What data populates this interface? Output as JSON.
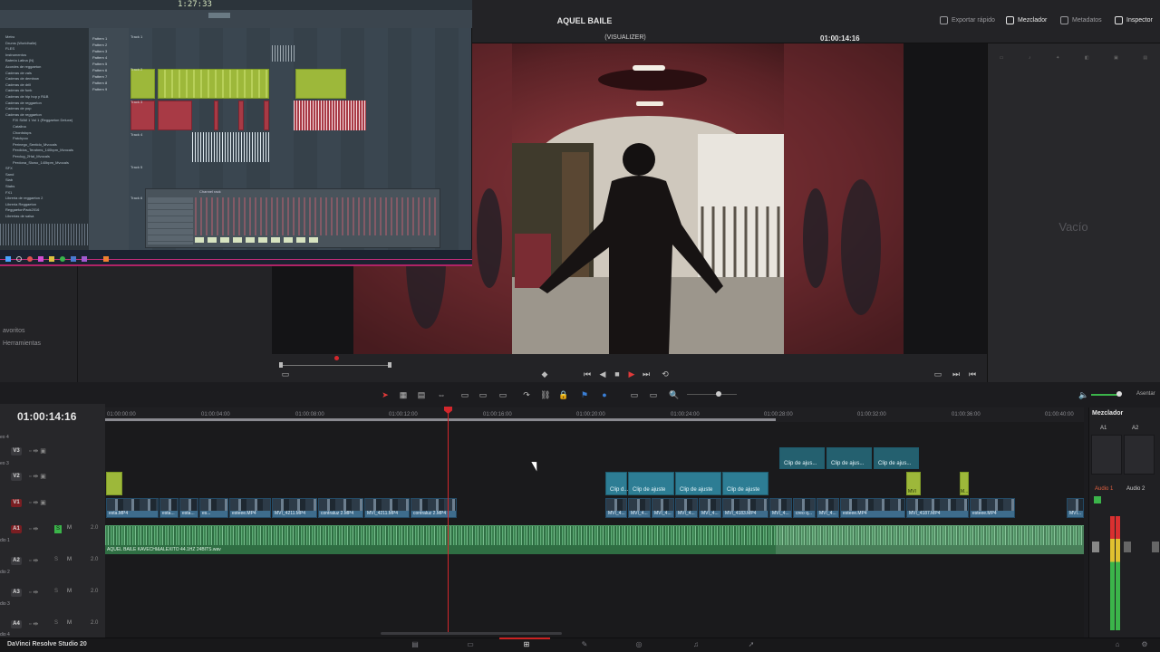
{
  "app": {
    "name": "DaVinci Resolve Studio 20"
  },
  "header": {
    "project_title": "AQUEL BAILE",
    "quick_export": "Exportar rápido",
    "mixer": "Mezclador",
    "metadata": "Metadatos",
    "inspector": "Inspector"
  },
  "viewer": {
    "mode_label": "(VISUALIZER)",
    "timecode": "01:00:14:16"
  },
  "inspector": {
    "empty_label": "Vacío"
  },
  "left_panel": {
    "favorites": "avoritos",
    "tools": "Herramientas"
  },
  "timeline": {
    "timecode": "01:00:14:16",
    "ruler_ticks": [
      "01:00:00:00",
      "01:00:04:00",
      "01:00:08:00",
      "01:00:12:00",
      "01:00:16:00",
      "01:00:20:00",
      "01:00:24:00",
      "01:00:28:00",
      "01:00:32:00",
      "01:00:36:00",
      "01:00:40:00"
    ],
    "tracks": {
      "v3": "V3",
      "v2": "V2",
      "v1": "V1",
      "a1": "A1",
      "a2": "A2",
      "a3": "A3",
      "a4": "A4",
      "eo4": "eo 4",
      "eo3": "eo 3",
      "dio1": "dio 1",
      "dio2": "dio 2",
      "dio3": "dio 3",
      "dio4": "dio 4",
      "a1_level": "2.0",
      "a2_level": "2.0",
      "a3_level": "2.0",
      "a4_level": "2.0",
      "mute": "M",
      "solo": "S"
    },
    "v1_clips": [
      "esta.MP4",
      "esta...",
      "esta...",
      "es...",
      "esteee.MP4",
      "MVI_4211.MP4",
      "contraluz 2.MP4",
      "MVI_4211.MP4",
      "contraluz 2.MP4",
      "MVI_4...",
      "MVI_4...",
      "MVI_4...",
      "MVI_4...",
      "MVI_4...",
      "MVI_4183.MP4",
      "MVI_4...",
      "creo q...",
      "MVI_4...",
      "esteee.MP4",
      "MVI_4187.MP4",
      "esteee.MP4",
      "MVI..."
    ],
    "v2_adjust": [
      "Clip d...",
      "Clip de ajuste",
      "Clip de ajuste",
      "Clip de ajuste"
    ],
    "v3_adjust": [
      "Clip de ajus...",
      "Clip de ajus...",
      "Clip de ajus..."
    ],
    "green_clip_a": "MVI",
    "green_clip_b": "M...",
    "audio_clip": "AQUEL BAILE KAVECHI&ALEXITO 44.1HZ 24BITS.wav",
    "volume_label": "Asentar"
  },
  "mixer": {
    "title": "Mezclador",
    "ch_a1": "A1",
    "ch_a2": "A2",
    "audio1": "Audio 1",
    "audio2": "Audio 2"
  },
  "fl_studio": {
    "tempo": "1:27:33",
    "browser_items": [
      "Metro",
      "Drums (Worldhalle)",
      "FLES",
      "Instrumentos",
      "Bateria Latina (N)",
      "Acordes de reggaeton",
      "Caderas de vals",
      "Caderas de dembow",
      "Caderas de drill",
      "Caderas de funk",
      "Caderas de hip hop y R&B",
      "Caderas de reggaeton",
      "Caderas de pop",
      "Caderas de reggaeton",
      "FIX SAM 1 Vol 1 (Reggaeton Deluxe)",
      "Catalina",
      "Chordstops",
      "Patchpoo",
      "Perinego_Sentido_Mvocals",
      "Perdidos_Terahms_140bpm_Mvocals",
      "Perclug_2Hal_Mvocals",
      "Perdona_Slowo_140bpm_Mvocals",
      "SFX",
      "Sand",
      "Slab",
      "Stabs",
      "FX1",
      "Libreria de reggaeton 2",
      "Libreria Reggaeton",
      "ReggaetonPack2016",
      "Librerias de salsa"
    ],
    "channels": [
      "Pattern 1",
      "Pattern 2",
      "Pattern 3",
      "Pattern 4",
      "Pattern 5",
      "Pattern 6",
      "Pattern 7",
      "Pattern 8",
      "Pattern 9"
    ],
    "pattern_label": "Pattern 1",
    "track_labels": [
      "Track 1",
      "Track 2",
      "Track 3",
      "Track 4",
      "Track 5",
      "Track 6"
    ],
    "piano_roll_title": "Channel rack"
  }
}
